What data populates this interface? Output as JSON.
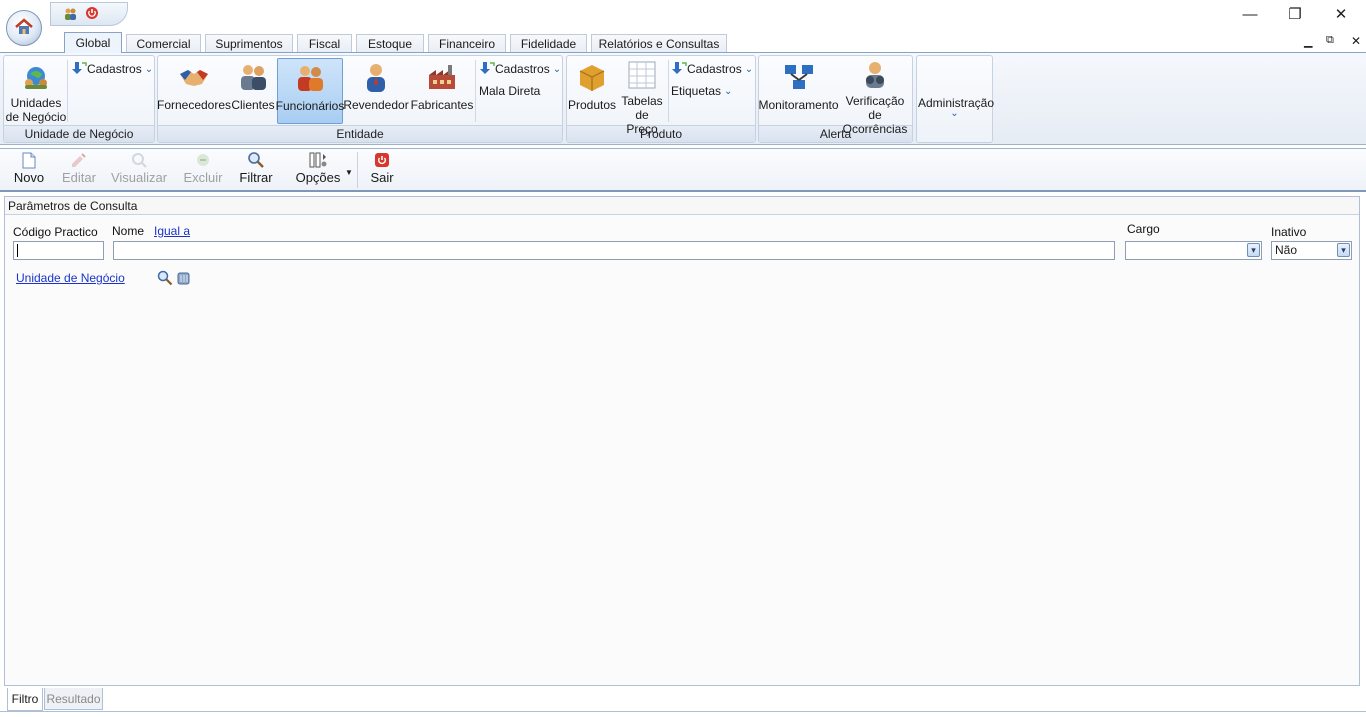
{
  "window": {
    "minimize": "—",
    "restore": "❐",
    "close": "✕",
    "inner_min": "▁",
    "inner_restore": "🗗",
    "inner_close": "✕"
  },
  "tabs": [
    "Global",
    "Comercial",
    "Suprimentos",
    "Fiscal",
    "Estoque",
    "Financeiro",
    "Fidelidade",
    "Relatórios e Consultas"
  ],
  "active_tab": "Global",
  "ribbon": {
    "unidade": {
      "group_label": "Unidade de Negócio",
      "btn_unidades": "Unidades\nde Negócio",
      "cadastros": "Cadastros"
    },
    "entidade": {
      "group_label": "Entidade",
      "fornecedores": "Fornecedores",
      "clientes": "Clientes",
      "funcionarios": "Funcionários",
      "revendedor": "Revendedor",
      "fabricantes": "Fabricantes",
      "cadastros": "Cadastros",
      "mala_direta": "Mala Direta"
    },
    "produto": {
      "group_label": "Produto",
      "produtos": "Produtos",
      "tabelas": "Tabelas\nde Preço",
      "cadastros": "Cadastros",
      "etiquetas": "Etiquetas"
    },
    "alerta": {
      "group_label": "Alerta",
      "monitoramento": "Monitoramento",
      "verificacao": "Verificação de\nOcorrências"
    },
    "administracao": "Administração",
    "chevron": "⌄"
  },
  "toolbar": {
    "novo": "Novo",
    "editar": "Editar",
    "visualizar": "Visualizar",
    "excluir": "Excluir",
    "filtrar": "Filtrar",
    "opcoes": "Opções",
    "sair": "Sair"
  },
  "panel": {
    "title": "Parâmetros de Consulta",
    "codigo_label": "Código Practico",
    "codigo_value": "",
    "nome_label": "Nome",
    "nome_operator": "Igual a",
    "nome_value": "",
    "cargo_label": "Cargo",
    "cargo_value": "",
    "inativo_label": "Inativo",
    "inativo_value": "Não",
    "unidade_link": "Unidade de Negócio"
  },
  "bottom_tabs": [
    "Filtro",
    "Resultado"
  ],
  "active_bottom_tab": "Filtro",
  "colors": {
    "accent": "#6f9fd4",
    "link": "#1a33cc",
    "ribbon_border": "#8aa3c4",
    "sair_red": "#d9372b"
  }
}
